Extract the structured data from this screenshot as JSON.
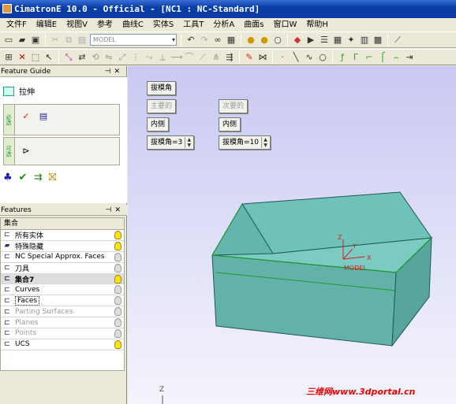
{
  "window": {
    "title": "CimatronE 10.0 - Official - [NC1 : NC-Standard]"
  },
  "menu": [
    "文件F",
    "编辑E",
    "视图V",
    "参考",
    "曲线C",
    "实体S",
    "工具T",
    "分析A",
    "曲面s",
    "窗口W",
    "帮助H"
  ],
  "toolbar": {
    "combo_model": "MODEL"
  },
  "feature_guide": {
    "panel_title": "Feature Guide",
    "feature_name": "拉伸",
    "step1_tag": "必选",
    "step2_tag": "可选",
    "icons": [
      "extrude-icon",
      "step-geom-icon",
      "step-dir-icon",
      "step-option-icon",
      "preview-icon",
      "ok-icon",
      "apply-icon",
      "cancel-icon"
    ]
  },
  "features": {
    "panel_title": "Features",
    "column_header": "集合",
    "rows": [
      {
        "label": "所有实体",
        "icon": "set-icon",
        "visible": true,
        "style": "normal"
      },
      {
        "label": "特殊隐藏",
        "icon": "folder-icon",
        "visible": true,
        "style": "normal"
      },
      {
        "label": "NC Special Approx. Faces",
        "icon": "set-icon",
        "visible": false,
        "style": "normal"
      },
      {
        "label": "刀具",
        "icon": "set-icon",
        "visible": false,
        "style": "normal"
      },
      {
        "label": "集合7",
        "icon": "set-icon",
        "visible": true,
        "style": "selected"
      },
      {
        "label": "Curves",
        "icon": "set-icon",
        "visible": false,
        "style": "normal"
      },
      {
        "label": "Faces",
        "icon": "set-icon",
        "visible": false,
        "style": "boxed"
      },
      {
        "label": "Parting Surfaces",
        "icon": "set-icon",
        "visible": false,
        "style": "gray"
      },
      {
        "label": "Planes",
        "icon": "set-icon",
        "visible": false,
        "style": "gray"
      },
      {
        "label": "Points",
        "icon": "set-icon",
        "visible": false,
        "style": "gray"
      },
      {
        "label": "UCS",
        "icon": "set-icon",
        "visible": true,
        "style": "normal"
      }
    ]
  },
  "viewport": {
    "draft_angle_button": "拔模角",
    "primary_button": "主要的",
    "secondary_button": "次要的",
    "inside_left": "内侧",
    "inside_right": "内侧",
    "angle_left": "拔模角=3",
    "angle_right": "拔模角=10",
    "axis_z": "Z",
    "axis_x": "X",
    "axis_y": "Y",
    "axis_label": "MODEL",
    "corner_axis_z": "Z",
    "colors": {
      "box_fill": "#5fb5ad",
      "box_edge": "#1e5a50",
      "inner_edge": "#1a9e2a",
      "axis_red": "#d02020"
    }
  },
  "watermark": "三维网www.3dportal.cn"
}
